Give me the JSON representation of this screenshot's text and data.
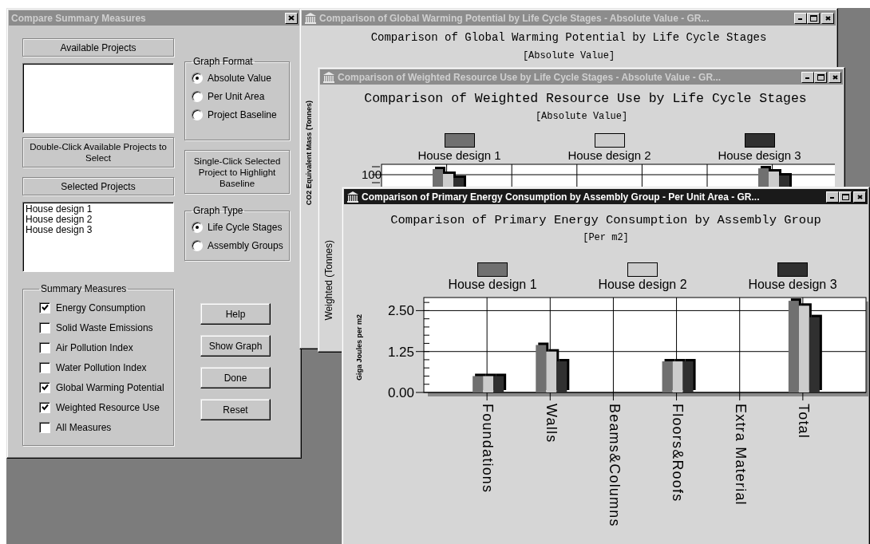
{
  "dialog": {
    "title": "Compare Summary Measures",
    "active": false,
    "available_projects_label": "Available Projects",
    "available_projects_hint": "Double-Click Available Projects to Select",
    "selected_projects_label": "Selected Projects",
    "selected_projects": [
      "House design 1",
      "House design 2",
      "House design 3"
    ],
    "graph_format": {
      "label": "Graph Format",
      "options": [
        {
          "label": "Absolute Value",
          "selected": true
        },
        {
          "label": "Per Unit Area",
          "selected": false
        },
        {
          "label": "Project Baseline",
          "selected": false
        }
      ]
    },
    "baseline_hint": "Single-Click Selected Project to Highlight Baseline",
    "graph_type": {
      "label": "Graph Type",
      "options": [
        {
          "label": "Life Cycle Stages",
          "selected": true
        },
        {
          "label": "Assembly Groups",
          "selected": false
        }
      ]
    },
    "summary_measures": {
      "label": "Summary Measures",
      "items": [
        {
          "label": "Energy Consumption",
          "checked": true
        },
        {
          "label": "Solid Waste Emissions",
          "checked": false
        },
        {
          "label": "Air Pollution Index",
          "checked": false
        },
        {
          "label": "Water Pollution Index",
          "checked": false
        },
        {
          "label": "Global Warming Potential",
          "checked": true
        },
        {
          "label": "Weighted Resource Use",
          "checked": true
        },
        {
          "label": "All Measures",
          "checked": false
        }
      ]
    },
    "buttons": [
      "Help",
      "Show Graph",
      "Done",
      "Reset"
    ]
  },
  "windows": [
    {
      "title": "Comparison of Global Warming Potential by Life Cycle Stages - Absolute Value - GR...",
      "active": false,
      "heading": "Comparison of Global Warming Potential by Life Cycle Stages",
      "subtitle": "[Absolute Value]",
      "ylabel": "CO2 Equivalent Mass (Tonnes)"
    },
    {
      "title": "Comparison of Weighted Resource Use by Life Cycle Stages - Absolute Value - GR...",
      "active": false,
      "heading": "Comparison of Weighted Resource Use by Life Cycle Stages",
      "subtitle": "[Absolute Value]",
      "legend": [
        {
          "label": "House design 1",
          "color": "#707070"
        },
        {
          "label": "House design 2",
          "color": "#cccccc"
        },
        {
          "label": "House design 3",
          "color": "#303030"
        }
      ],
      "ylabel": "Weighted (Tonnes)",
      "tick_label": "100"
    },
    {
      "title": "Comparison of Primary Energy Consumption by Assembly Group - Per Unit Area - GR...",
      "active": true,
      "heading": "Comparison of Primary Energy Consumption by Assembly Group",
      "subtitle": "[Per m2]",
      "chart_data": {
        "type": "bar",
        "ylabel": "Giga Joules per m2",
        "categories": [
          "Foundations",
          "Walls",
          "Beams&Columns",
          "Floors&Roofs",
          "Extra Material",
          "Total"
        ],
        "series": [
          {
            "name": "House design 1",
            "color": "#707070",
            "values": [
              0.5,
              1.45,
              0,
              0.95,
              0,
              2.8
            ]
          },
          {
            "name": "House design 2",
            "color": "#cccccc",
            "values": [
              0.5,
              1.25,
              0,
              0.95,
              0,
              2.65
            ]
          },
          {
            "name": "House design 3",
            "color": "#303030",
            "values": [
              0.5,
              0.95,
              0,
              0.95,
              0,
              2.3
            ]
          }
        ],
        "ylim": [
          0,
          2.9
        ],
        "grid": true,
        "yticks": [
          {
            "value": 0,
            "label": "0.00"
          },
          {
            "value": 1.25,
            "label": "1.25"
          },
          {
            "value": 2.5,
            "label": "2.50"
          }
        ]
      }
    }
  ]
}
